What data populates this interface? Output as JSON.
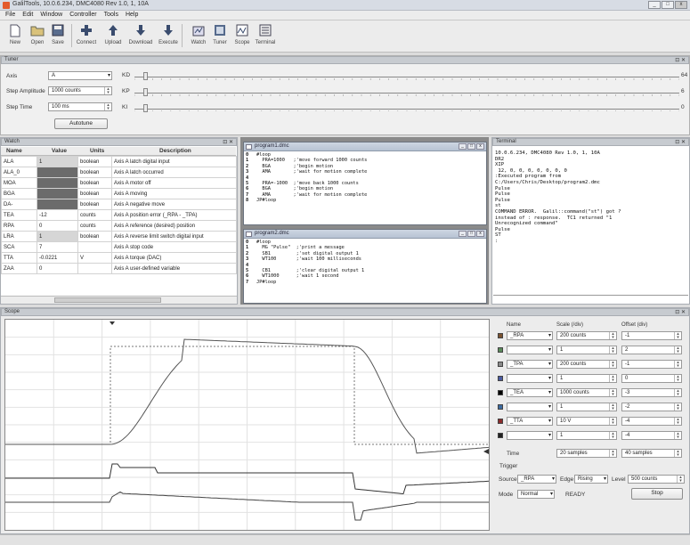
{
  "window": {
    "title": "GalilTools, 10.0.6.234, DMC4080 Rev 1.0, 1, 10A"
  },
  "menu": [
    "File",
    "Edit",
    "Window",
    "Controller",
    "Tools",
    "Help"
  ],
  "toolbar": [
    {
      "label": "New",
      "icon": "new-file-icon"
    },
    {
      "label": "Open",
      "icon": "open-folder-icon"
    },
    {
      "label": "Save",
      "icon": "save-disk-icon"
    },
    {
      "label": "Connect",
      "icon": "connect-plug-icon"
    },
    {
      "label": "Upload",
      "icon": "upload-arrow-icon"
    },
    {
      "label": "Download",
      "icon": "download-arrow-icon"
    },
    {
      "label": "Execute",
      "icon": "execute-arrow-icon"
    },
    {
      "label": "Watch",
      "icon": "watch-icon"
    },
    {
      "label": "Tuner",
      "icon": "tuner-icon"
    },
    {
      "label": "Scope",
      "icon": "scope-icon"
    },
    {
      "label": "Terminal",
      "icon": "terminal-icon"
    }
  ],
  "tuner": {
    "title": "Tuner",
    "axis_label": "Axis",
    "axis_value": "A",
    "step_amp_label": "Step Amplitude",
    "step_amp_value": "1000 counts",
    "step_time_label": "Step Time",
    "step_time_value": "100 ms",
    "autotune_label": "Autotune",
    "kd_label": "KD",
    "kp_label": "KP",
    "ki_label": "KI",
    "kd_value": "64",
    "kp_value": "6",
    "ki_value": "0",
    "kd_level": 0.02,
    "kp_level": 0.02,
    "ki_level": 0.02
  },
  "watch": {
    "title": "Watch",
    "headers": [
      "Name",
      "Value",
      "Units",
      "Description"
    ],
    "rows": [
      {
        "name": "ALA",
        "value": "1",
        "units": "boolean",
        "desc": "Axis A latch digital input",
        "dark": false
      },
      {
        "name": "ALA_0",
        "value": "",
        "units": "boolean",
        "desc": "Axis A latch occurred",
        "dark": true
      },
      {
        "name": "MOA",
        "value": "",
        "units": "boolean",
        "desc": "Axis A motor off",
        "dark": true
      },
      {
        "name": "BGA",
        "value": "",
        "units": "boolean",
        "desc": "Axis A moving",
        "dark": true
      },
      {
        "name": "DA-",
        "value": "",
        "units": "boolean",
        "desc": "Axis A negative move",
        "dark": true
      },
      {
        "name": "TEA",
        "value": "-12",
        "units": "counts",
        "desc": "Axis A position error (_RPA - _TPA)",
        "dark": false
      },
      {
        "name": "RPA",
        "value": "0",
        "units": "counts",
        "desc": "Axis A reference (desired) position",
        "dark": false
      },
      {
        "name": "LRA",
        "value": "1",
        "units": "boolean",
        "desc": "Axis A reverse limit switch digital input",
        "dark": false
      },
      {
        "name": "SCA",
        "value": "7",
        "units": "",
        "desc": "Axis A stop code",
        "dark": false
      },
      {
        "name": "TTA",
        "value": "-0.0221",
        "units": "V",
        "desc": "Axis A torque (DAC)",
        "dark": false
      },
      {
        "name": "ZAA",
        "value": "0",
        "units": "",
        "desc": "Axis A user-defined variable",
        "dark": false
      }
    ]
  },
  "editor1": {
    "title": "program1.dmc",
    "lines": [
      "0",
      "1",
      "2",
      "3",
      "4",
      "5",
      "6",
      "7",
      "8"
    ],
    "code": "#loop\n  PRA=1000   ;'move forward 1000 counts\n  BGA        ;'begin motion\n  AMA        ;'wait for motion complete\n\n  PRA=-1000  ;'move back 1000 counts\n  BGA        ;'begin motion\n  AMA        ;'wait for motion complete\nJP#loop"
  },
  "editor2": {
    "title": "program2.dmc",
    "lines": [
      "0",
      "1",
      "2",
      "3",
      "4",
      "5",
      "6",
      "7"
    ],
    "code": "#loop\n  MG \"Pulse\"  ;'print a message\n  SB1         ;'set digital output 1\n  WT100       ;'wait 100 milliseconds\n\n  CB1         ;'clear digital output 1\n  WT1000      ;'wait 1 second\nJP#loop"
  },
  "terminal": {
    "title": "Terminal",
    "text": "10.0.6.234, DMC4080 Rev 1.0, 1, 10A\nDR2\nXIP\n 12, 0, 0, 0, 0, 0, 0, 0\n:Executed program from\nC:/Users/Chris/Desktop/program2.dmc\nPulse\nPulse\nPulse\nst\nCOMMAND ERROR.  Galil::command(\"st\") got ?\ninstead of : response.  TC1 returned \"1\nUnrecognized command\"\nPulse\nST\n:"
  },
  "scope": {
    "title": "Scope",
    "headers": {
      "name": "Name",
      "scale": "Scale (/div)",
      "offset": "Offset (div)"
    },
    "channels": [
      {
        "name": "_RPA",
        "scale": "200 counts",
        "offset": "-1",
        "color": "#7a5230"
      },
      {
        "name": "",
        "scale": "1",
        "offset": "2",
        "color": "#5a8a5a"
      },
      {
        "name": "_TPA",
        "scale": "200 counts",
        "offset": "-1",
        "color": "#8a8a8a"
      },
      {
        "name": "",
        "scale": "1",
        "offset": "0",
        "color": "#4a5aa0"
      },
      {
        "name": "_TEA",
        "scale": "1000 counts",
        "offset": "-3",
        "color": "#000000"
      },
      {
        "name": "",
        "scale": "1",
        "offset": "-2",
        "color": "#3a6aa0"
      },
      {
        "name": "_TTA",
        "scale": "10 V",
        "offset": "-4",
        "color": "#8a2a2a"
      },
      {
        "name": "",
        "scale": "1",
        "offset": "-4",
        "color": "#222222"
      }
    ],
    "time_label": "Time",
    "time_value": "20 samples",
    "time_offset": "40 samples",
    "trigger_label": "Trigger",
    "source_label": "Source",
    "source_value": "_RPA",
    "edge_label": "Edge",
    "edge_value": "Rising",
    "level_label": "Level",
    "level_value": "500 counts",
    "mode_label": "Mode",
    "mode_value": "Normal",
    "status_text": "READY",
    "stop_label": "Stop"
  }
}
